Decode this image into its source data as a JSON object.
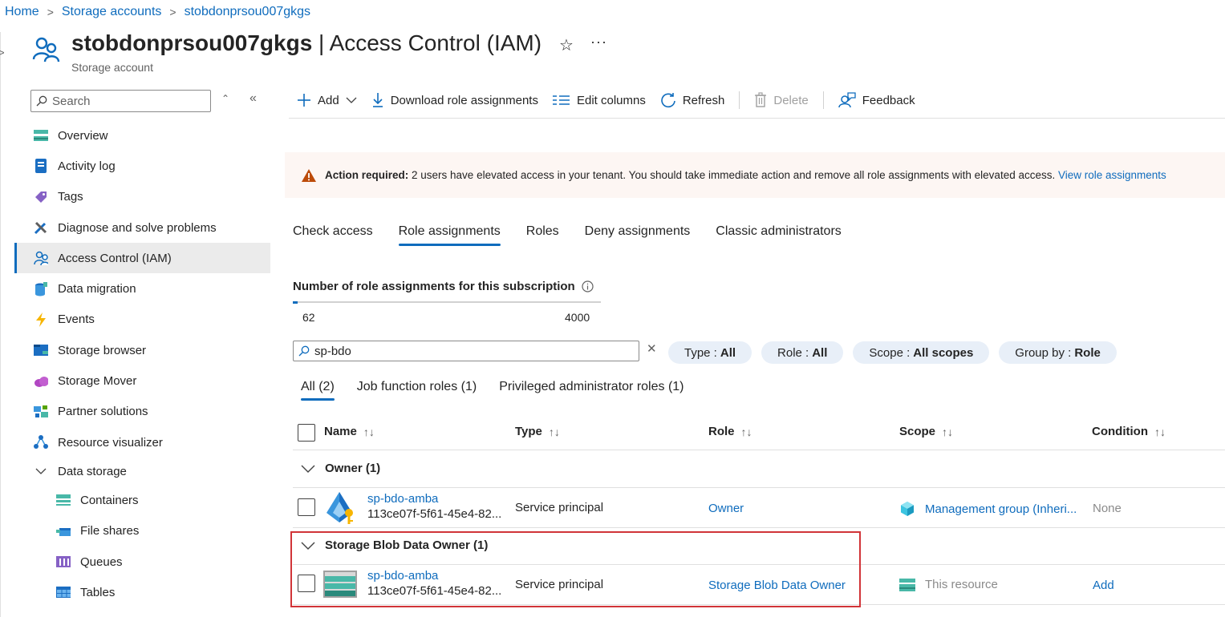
{
  "breadcrumb": [
    "Home",
    "Storage accounts",
    "stobdonprsou007gkgs"
  ],
  "header": {
    "resource_name": "stobdonprsou007gkgs",
    "separator": " | ",
    "page_title": "Access Control (IAM)",
    "subtitle": "Storage account",
    "more": "···"
  },
  "sidebar": {
    "search_placeholder": "Search",
    "items": [
      {
        "label": "Overview",
        "icon": "overview-icon"
      },
      {
        "label": "Activity log",
        "icon": "activity-log-icon"
      },
      {
        "label": "Tags",
        "icon": "tag-icon"
      },
      {
        "label": "Diagnose and solve problems",
        "icon": "wrench-icon"
      },
      {
        "label": "Access Control (IAM)",
        "icon": "people-icon",
        "active": true
      },
      {
        "label": "Data migration",
        "icon": "data-migration-icon"
      },
      {
        "label": "Events",
        "icon": "lightning-icon"
      },
      {
        "label": "Storage browser",
        "icon": "storage-browser-icon"
      },
      {
        "label": "Storage Mover",
        "icon": "cloud-icon"
      },
      {
        "label": "Partner solutions",
        "icon": "partner-icon"
      },
      {
        "label": "Resource visualizer",
        "icon": "visualizer-icon"
      },
      {
        "label": "Data storage",
        "icon": "chevron-down-icon",
        "section": true
      },
      {
        "label": "Containers",
        "icon": "containers-icon",
        "sub": true
      },
      {
        "label": "File shares",
        "icon": "file-shares-icon",
        "sub": true
      },
      {
        "label": "Queues",
        "icon": "queues-icon",
        "sub": true
      },
      {
        "label": "Tables",
        "icon": "tables-icon",
        "sub": true
      }
    ]
  },
  "toolbar": {
    "add": "Add",
    "download": "Download role assignments",
    "edit_columns": "Edit columns",
    "refresh": "Refresh",
    "delete": "Delete",
    "feedback": "Feedback"
  },
  "banner": {
    "bold": "Action required:",
    "text": " 2 users have elevated access in your tenant. You should take immediate action and remove all role assignments with elevated access. ",
    "link": "View role assignments",
    "color": "#bc4b09"
  },
  "tabs": [
    "Check access",
    "Role assignments",
    "Roles",
    "Deny assignments",
    "Classic administrators"
  ],
  "count": {
    "label": "Number of role assignments for this subscription",
    "current": "62",
    "max": "4000",
    "fraction": 0.0155
  },
  "filter": {
    "value": "sp-bdo",
    "pills": [
      {
        "key": "Type : ",
        "value": "All"
      },
      {
        "key": "Role : ",
        "value": "All"
      },
      {
        "key": "Scope : ",
        "value": "All scopes"
      },
      {
        "key": "Group by : ",
        "value": "Role"
      }
    ]
  },
  "subtabs": [
    "All (2)",
    "Job function roles (1)",
    "Privileged administrator roles (1)"
  ],
  "table": {
    "columns": [
      "Name",
      "Type",
      "Role",
      "Scope",
      "Condition"
    ],
    "sort_glyph": "↑↓",
    "groups": [
      {
        "title": "Owner (1)",
        "rows": [
          {
            "name": "sp-bdo-amba",
            "id": "113ce07f-5f61-45e4-82...",
            "type": "Service principal",
            "role": "Owner",
            "scope": "Management group (Inheri...",
            "condition": "None"
          }
        ]
      },
      {
        "title": "Storage Blob Data Owner (1)",
        "rows": [
          {
            "name": "sp-bdo-amba",
            "id": "113ce07f-5f61-45e4-82...",
            "type": "Service principal",
            "role": "Storage Blob Data Owner",
            "scope": "This resource",
            "condition": "Add"
          }
        ]
      }
    ]
  },
  "colors": {
    "accent": "#0f6cbd",
    "highlight_box": "#d13438"
  }
}
